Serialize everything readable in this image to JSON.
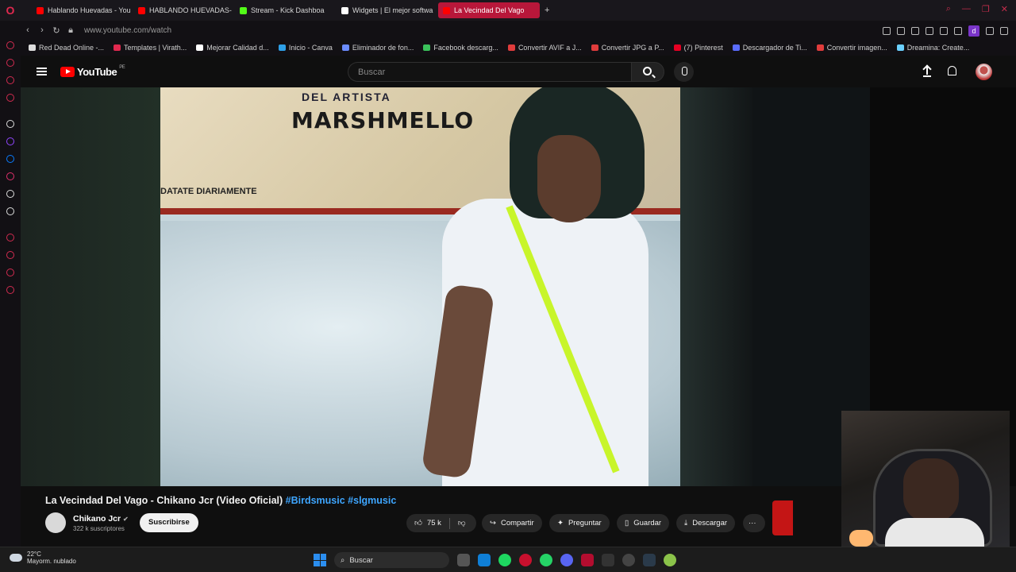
{
  "browser": {
    "tabs": [
      {
        "label": "Hablando Huevadas - You",
        "color": "#ff0000"
      },
      {
        "label": "HABLANDO HUEVADAS- ",
        "color": "#ff0000"
      },
      {
        "label": "Stream - Kick Dashboa",
        "color": "#53fc18"
      },
      {
        "label": "Widgets | El mejor softwa",
        "color": "#ffffff"
      },
      {
        "label": "La Vecindad Del Vago",
        "color": "#ff0000",
        "active": true
      }
    ],
    "new_tab": "+",
    "url": "www.youtube.com/watch",
    "bookmarks": [
      {
        "label": "Red Dead Online -...",
        "color": "#ddd"
      },
      {
        "label": "Templates | Virath...",
        "color": "#e0294f"
      },
      {
        "label": "Mejorar Calidad d...",
        "color": "#fff"
      },
      {
        "label": "Inicio - Canva",
        "color": "#2ea0e8"
      },
      {
        "label": "Eliminador de fon...",
        "color": "#6b8cff"
      },
      {
        "label": "Facebook descarg...",
        "color": "#3ac15a"
      },
      {
        "label": "Convertir AVIF a J...",
        "color": "#e03c3c"
      },
      {
        "label": "Convertir JPG a P...",
        "color": "#e03c3c"
      },
      {
        "label": "(7) Pinterest",
        "color": "#e60023"
      },
      {
        "label": "Descargador de Ti...",
        "color": "#5a6cff"
      },
      {
        "label": "Convertir imagen...",
        "color": "#e03c3c"
      },
      {
        "label": "Dreamina: Create...",
        "color": "#6bd1ff"
      }
    ],
    "profile_letter": "d"
  },
  "youtube": {
    "logo_text": "YouTube",
    "country_code": "PE",
    "search_placeholder": "Buscar"
  },
  "video": {
    "title": "La Vecindad Del Vago - Chikano Jcr (Video Oficial)",
    "hashtags": "#Birdsmusic #slgmusic",
    "poster_line1": "DEL ARTISTA",
    "poster_line2": "MARSHMELLO",
    "poster_line3": "DATATE DIARIAMENTE",
    "channel_name": "Chikano Jcr",
    "subscribers": "322 k suscriptores",
    "subscribe_label": "Suscribirse",
    "likes": "75 k",
    "share_label": "Compartir",
    "ask_label": "Preguntar",
    "save_label": "Guardar",
    "download_label": "Descargar",
    "more_label": "···"
  },
  "taskbar": {
    "temperature": "22°C",
    "weather": "Mayorm. nublado",
    "search_label": "Buscar"
  }
}
